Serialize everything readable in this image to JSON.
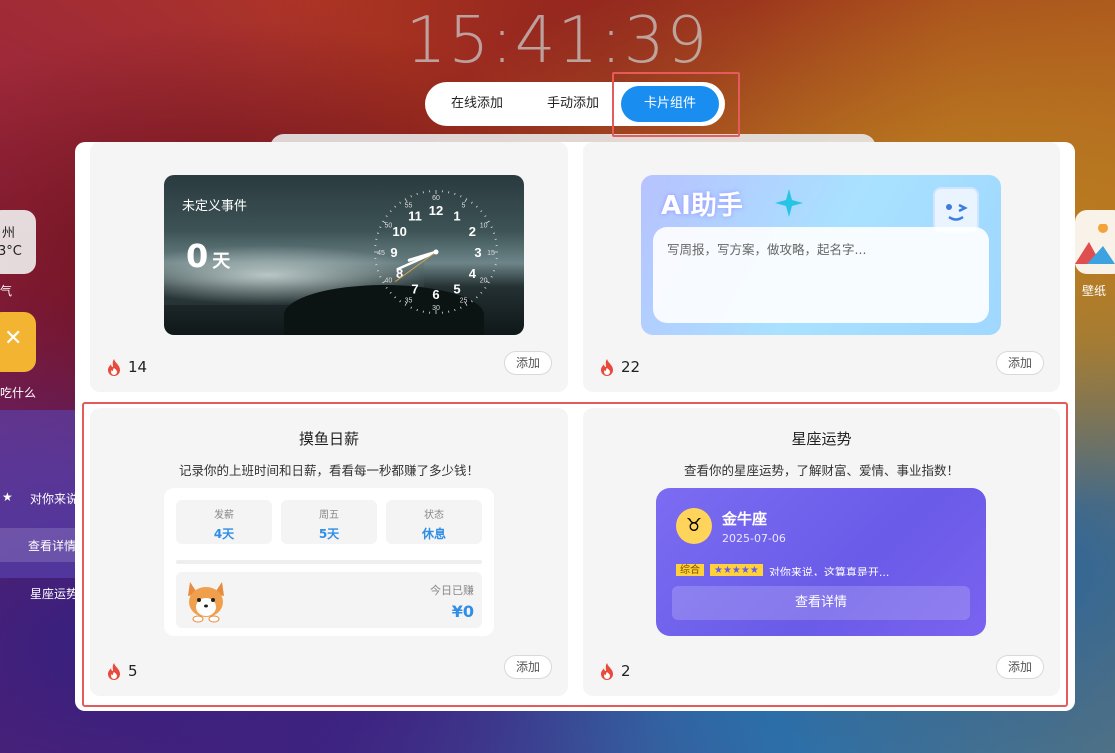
{
  "clock": "15:41:39",
  "tabs": [
    {
      "label": "在线添加"
    },
    {
      "label": "手动添加"
    },
    {
      "label": "卡片组件"
    }
  ],
  "side": {
    "city": "州",
    "temp": "3°C",
    "weather_label": "气",
    "food_label": "吃什么",
    "wallpaper_label": "壁纸",
    "horoscope_text": "对你来说",
    "view_detail": "查看详情",
    "horoscope_label": "星座运势"
  },
  "cards": [
    {
      "title": "",
      "heat": "14",
      "add": "添加",
      "preview": {
        "event": "未定义事件",
        "days": "0",
        "unit": "天",
        "clock_numbers": [
          "12",
          "1",
          "2",
          "3",
          "4",
          "5",
          "6",
          "7",
          "8",
          "9",
          "10",
          "11"
        ],
        "clock_minutes": [
          "60",
          "5",
          "10",
          "15",
          "20",
          "25",
          "30",
          "35",
          "40",
          "45",
          "50",
          "55"
        ]
      }
    },
    {
      "title": "",
      "heat": "22",
      "add": "添加",
      "preview": {
        "title": "AI助手",
        "placeholder": "写周报，写方案，做攻略，起名字..."
      }
    },
    {
      "title": "摸鱼日薪",
      "desc": "记录你的上班时间和日薪，看看每一秒都赚了多少钱！",
      "heat": "5",
      "add": "添加",
      "preview": {
        "stats": [
          {
            "label": "发薪",
            "value": "4天"
          },
          {
            "label": "周五",
            "value": "5天"
          },
          {
            "label": "状态",
            "value": "休息"
          }
        ],
        "earned_label": "今日已赚",
        "earned_value": "¥0"
      }
    },
    {
      "title": "星座运势",
      "desc": "查看你的星座运势，了解财富、爱情、事业指数！",
      "heat": "2",
      "add": "添加",
      "preview": {
        "sign": "金牛座",
        "date": "2025-07-06",
        "tag": "综合",
        "stars": "★★★★★",
        "text": "对你来说，这算真是开...",
        "button": "查看详情"
      }
    }
  ],
  "colors": {
    "accent": "#1a8df0",
    "highlight": "#e35b5b",
    "flame": "#e84a3c"
  }
}
